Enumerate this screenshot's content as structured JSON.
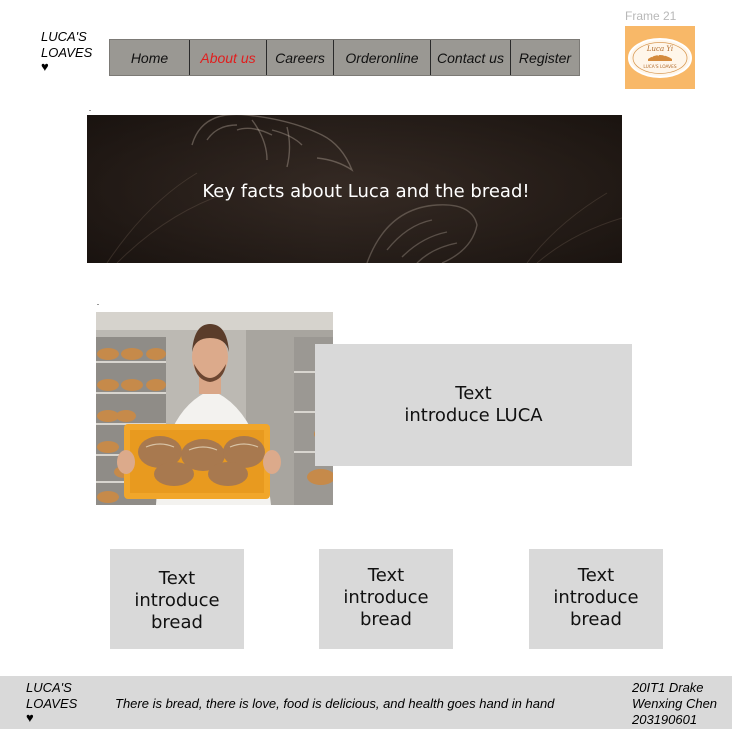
{
  "brand": {
    "line1": "LUCA'S",
    "line2": "LOAVES",
    "heart": "♥"
  },
  "nav": {
    "items": [
      {
        "label": "Home",
        "active": false
      },
      {
        "label": "About us",
        "active": true
      },
      {
        "label": "Careers",
        "active": false
      },
      {
        "label": "Orderonline",
        "active": false
      },
      {
        "label": "Contact us",
        "active": false
      },
      {
        "label": "Register",
        "active": false
      }
    ]
  },
  "frame": {
    "label": "Frame 21",
    "logo_top_text": "Luca Yi",
    "logo_bottom_text": "LUCA'S LOAVES",
    "logo_bg": "#f8b868"
  },
  "banner": {
    "text": "Key facts about Luca and the bread!"
  },
  "intro": {
    "line1": "Text",
    "line2": "introduce LUCA"
  },
  "bread_boxes": [
    {
      "text": "Text\nintroduce\nbread"
    },
    {
      "text": "Text\nintroduce\nbread"
    },
    {
      "text": "Text\nintroduce\nbread"
    }
  ],
  "footer": {
    "brand_line1": "LUCA'S",
    "brand_line2": "LOAVES",
    "heart": "♥",
    "slogan": "There is bread, there is love, food is delicious, and health goes hand in hand",
    "author_line1": "20IT1 Drake",
    "author_line2": "Wenxing Chen",
    "author_line3": "203190601"
  },
  "colors": {
    "nav_bg": "#9a9893",
    "active_nav": "#e11d1d",
    "panel_gray": "#d9d9d9",
    "banner_dark": "#2a201b"
  }
}
